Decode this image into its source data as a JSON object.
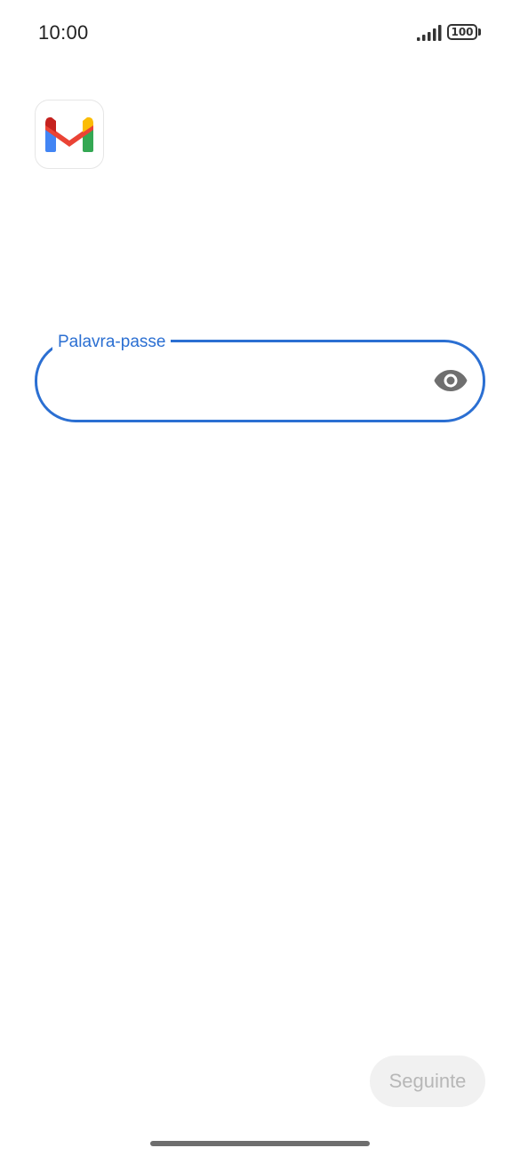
{
  "status_bar": {
    "time": "10:00",
    "battery_level": "100",
    "signal_icon": "cellular-signal-icon",
    "battery_icon": "battery-icon"
  },
  "app": {
    "logo_icon": "gmail-logo-icon",
    "colors": {
      "blue": "#4285F4",
      "red": "#EA4335",
      "yellow": "#FBBC04",
      "green": "#34A853",
      "dark_red": "#C5221F"
    }
  },
  "password_field": {
    "label": "Palavra-passe",
    "value": "",
    "toggle_icon": "eye-icon",
    "accent_color": "#2B6FD2"
  },
  "actions": {
    "next_label": "Seguinte",
    "next_disabled": true
  }
}
